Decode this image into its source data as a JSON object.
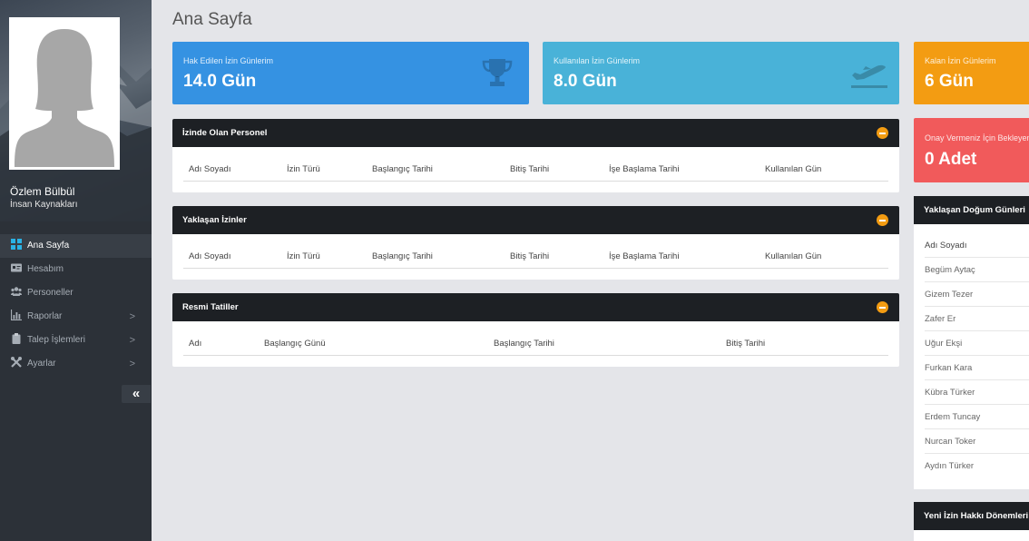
{
  "colors": {
    "sidebar": "#2c3138",
    "blue": "#3592e2",
    "cyan": "#49b2d8",
    "orange": "#f39c12",
    "red": "#f15a5b",
    "panel_head": "#1d2024"
  },
  "profile": {
    "name": "Özlem Bülbül",
    "role": "İnsan Kaynakları"
  },
  "menu": [
    {
      "label": "Ana Sayfa",
      "icon": "dashboard-icon"
    },
    {
      "label": "Hesabım",
      "icon": "id-card-icon"
    },
    {
      "label": "Personeller",
      "icon": "users-icon"
    },
    {
      "label": "Raporlar",
      "icon": "chart-icon",
      "arrow": ">"
    },
    {
      "label": "Talep İşlemleri",
      "icon": "clipboard-icon",
      "arrow": ">"
    },
    {
      "label": "Ayarlar",
      "icon": "tools-icon",
      "arrow": ">"
    }
  ],
  "collapse_label": "«",
  "page_title": "Ana Sayfa",
  "tiles": [
    {
      "label": "Hak Edilen İzin Günlerim",
      "value": "14.0 Gün",
      "icon": "trophy-icon"
    },
    {
      "label": "Kullanılan İzin Günlerim",
      "value": "8.0 Gün",
      "icon": "plane-icon"
    },
    {
      "label": "Kalan İzin Günlerim",
      "value": "6 Gün"
    },
    {
      "label": "Onay Vermeniz İçin Bekleyen",
      "value": "0 Adet"
    }
  ],
  "panels": [
    {
      "title": "İzinde Olan Personel",
      "columns": [
        "Adı Soyadı",
        "İzin Türü",
        "Başlangıç Tarihi",
        "Bitiş Tarihi",
        "İşe Başlama Tarihi",
        "Kullanılan Gün"
      ]
    },
    {
      "title": "Yaklaşan İzinler",
      "columns": [
        "Adı Soyadı",
        "İzin Türü",
        "Başlangıç Tarihi",
        "Bitiş Tarihi",
        "İşe Başlama Tarihi",
        "Kullanılan Gün"
      ]
    },
    {
      "title": "Resmi Tatiller",
      "columns": [
        "Adı",
        "Başlangıç Günü",
        "Başlangıç Tarihi",
        "Bitiş Tarihi"
      ]
    }
  ],
  "birthdays": {
    "title": "Yaklaşan Doğum Günleri",
    "header": "Adı Soyadı",
    "names": [
      "Begüm Aytaç",
      "Gizem Tezer",
      "Zafer Er",
      "Uğur Ekşi",
      "Furkan Kara",
      "Kübra Türker",
      "Erdem Tuncay",
      "Nurcan Toker",
      "Aydın Türker"
    ]
  },
  "new_periods": {
    "title": "Yeni İzin Hakkı Dönemleri"
  }
}
